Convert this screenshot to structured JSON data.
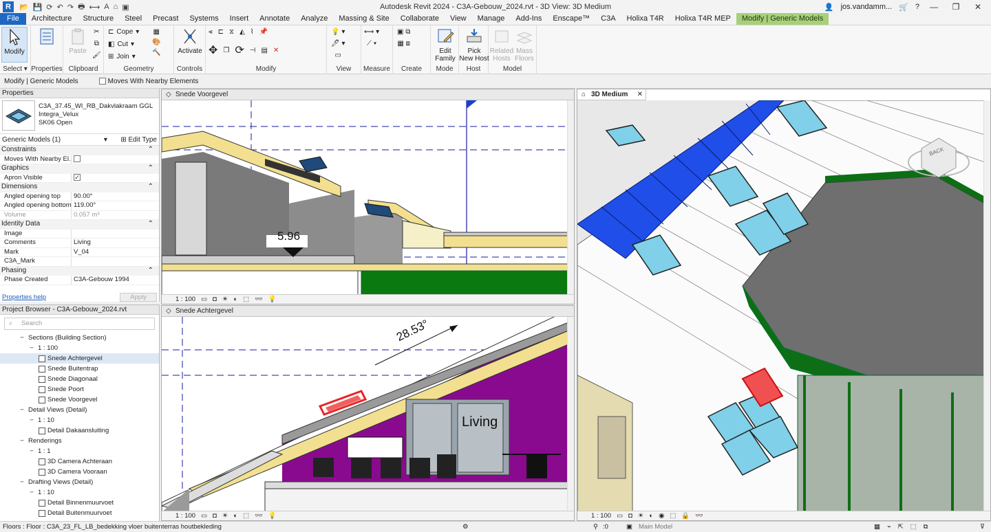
{
  "window": {
    "title": "Autodesk Revit 2024 - C3A-Gebouw_2024.rvt - 3D View: 3D Medium",
    "user": "jos.vandamm..."
  },
  "ribbon_tabs": [
    "File",
    "Architecture",
    "Structure",
    "Steel",
    "Precast",
    "Systems",
    "Insert",
    "Annotate",
    "Analyze",
    "Massing & Site",
    "Collaborate",
    "View",
    "Manage",
    "Add-Ins",
    "Enscape™",
    "C3A",
    "Holixa T4R",
    "Holixa T4R MEP",
    "Modify | Generic Models"
  ],
  "ribbon": {
    "select": {
      "modify": "Modify",
      "label": "Select"
    },
    "properties": {
      "label": "Properties"
    },
    "clipboard": {
      "paste": "Paste",
      "label": "Clipboard"
    },
    "geometry": {
      "cope": "Cope",
      "cut": "Cut",
      "join": "Join",
      "label": "Geometry"
    },
    "controls": {
      "activate": "Activate",
      "label": "Controls"
    },
    "modify": {
      "label": "Modify"
    },
    "view": {
      "label": "View"
    },
    "measure": {
      "label": "Measure"
    },
    "create": {
      "label": "Create"
    },
    "mode": {
      "edit_family_1": "Edit",
      "edit_family_2": "Family",
      "label": "Mode"
    },
    "host": {
      "pick_1": "Pick",
      "pick_2": "New Host",
      "label": "Host"
    },
    "model": {
      "related_1": "Related",
      "related_2": "Hosts",
      "mass_1": "Mass",
      "mass_2": "Floors",
      "label": "Model"
    }
  },
  "optionbar": {
    "context": "Modify | Generic Models",
    "moves_with": "Moves With Nearby Elements"
  },
  "properties": {
    "header": "Properties",
    "type_name_1": "C3A_37.45_WI_RB_Dakvlakraam GGL",
    "type_name_2": "Integra_Velux",
    "type_name_3": "SK06 Open",
    "instance_filter": "Generic Models (1)",
    "edit_type": "Edit Type",
    "groups": {
      "constraints": "Constraints",
      "graphics": "Graphics",
      "dimensions": "Dimensions",
      "identity": "Identity Data",
      "phasing": "Phasing"
    },
    "rows": {
      "moves_with": {
        "k": "Moves With Nearby El...",
        "v": ""
      },
      "apron": {
        "k": "Apron Visible",
        "v": ""
      },
      "angled_top": {
        "k": "Angled opening top",
        "v": "90.00°"
      },
      "angled_bottom": {
        "k": "Angled opening bottom",
        "v": "119.00°"
      },
      "volume": {
        "k": "Volume",
        "v": "0.057 m³"
      },
      "image": {
        "k": "Image",
        "v": ""
      },
      "comments": {
        "k": "Comments",
        "v": "Living"
      },
      "mark": {
        "k": "Mark",
        "v": "V_04"
      },
      "c3a_mark": {
        "k": "C3A_Mark",
        "v": ""
      },
      "phase": {
        "k": "Phase Created",
        "v": "C3A-Gebouw 1994"
      }
    },
    "help": "Properties help",
    "apply": "Apply"
  },
  "browser": {
    "header": "Project Browser - C3A-Gebouw_2024.rvt",
    "search_placeholder": "Search",
    "tree": [
      {
        "label": "Sections (Building Section)",
        "level": 1,
        "kind": "group"
      },
      {
        "label": "1 : 100",
        "level": 2,
        "kind": "group"
      },
      {
        "label": "Snede Achtergevel",
        "level": 3,
        "kind": "view",
        "selected": true
      },
      {
        "label": "Snede Buitentrap",
        "level": 3,
        "kind": "view"
      },
      {
        "label": "Snede Diagonaal",
        "level": 3,
        "kind": "view"
      },
      {
        "label": "Snede Poort",
        "level": 3,
        "kind": "view"
      },
      {
        "label": "Snede Voorgevel",
        "level": 3,
        "kind": "view"
      },
      {
        "label": "Detail Views (Detail)",
        "level": 1,
        "kind": "group"
      },
      {
        "label": "1 : 10",
        "level": 2,
        "kind": "group"
      },
      {
        "label": "Detail Dakaansluiting",
        "level": 3,
        "kind": "view"
      },
      {
        "label": "Renderings",
        "level": 1,
        "kind": "group"
      },
      {
        "label": "1 : 1",
        "level": 2,
        "kind": "group"
      },
      {
        "label": "3D Camera Achteraan",
        "level": 3,
        "kind": "view"
      },
      {
        "label": "3D Camera Vooraan",
        "level": 3,
        "kind": "view"
      },
      {
        "label": "Drafting Views (Detail)",
        "level": 1,
        "kind": "group"
      },
      {
        "label": "1 : 10",
        "level": 2,
        "kind": "group"
      },
      {
        "label": "Detail Binnenmuurvoet",
        "level": 3,
        "kind": "view"
      },
      {
        "label": "Detail Buitenmuurvoet",
        "level": 3,
        "kind": "view"
      }
    ]
  },
  "views": {
    "voorgevel": {
      "title": "Snede Voorgevel",
      "scale": "1 : 100",
      "level_value": "5.96"
    },
    "achtergevel": {
      "title": "Snede Achtergevel",
      "scale": "1 : 100",
      "angle": "28.53°",
      "room": "Living"
    },
    "medium": {
      "title": "3D Medium",
      "scale": "1 : 100",
      "cube_label": "BACK"
    }
  },
  "statusbar": {
    "text": "Floors : Floor : C3A_23_FL_LB_bedekking vloer buitenterras houtbekleding",
    "zero": ":0",
    "model": "Main Model"
  },
  "colors": {
    "accent": "#1e68c4",
    "context_tab": "#a8d07a",
    "wall_magenta": "#8a0a8f",
    "glass_blue": "#1f4fe8",
    "steel_green": "#0e6e15",
    "selection_red": "#e82424"
  }
}
